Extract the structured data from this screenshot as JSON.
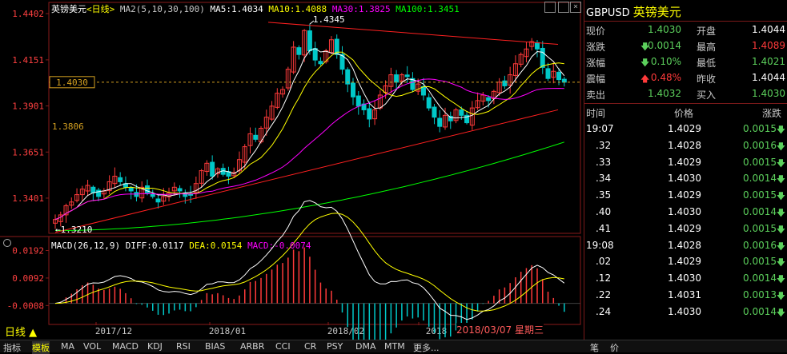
{
  "header": {
    "title": "英镑美元",
    "period": "<日线>",
    "ma_label": "MA2(5,10,30,100)",
    "ma5": "MA5:1.4034",
    "ma10": "MA10:1.4088",
    "ma30": "MA30:1.3825",
    "ma100": "MA100:1.3451"
  },
  "macd_header": {
    "label": "MACD(26,12,9)",
    "diff": "DIFF:0.0117",
    "dea": "DEA:0.0154",
    "macd": "MACD:-0.0074"
  },
  "annotations": {
    "high": "1.4345",
    "low": "1.3210",
    "current_tag": "1.4030",
    "support_label": "1.3806"
  },
  "price_axis": [
    "1.4402",
    "1.4151",
    "1.3901",
    "1.3651",
    "1.3401"
  ],
  "macd_axis": [
    "0.0192",
    "0.0092",
    "-0.0008"
  ],
  "x_axis": [
    "2017/12",
    "2018/01",
    "2018/02",
    "2018"
  ],
  "date_label": "2018/03/07 星期三",
  "period_button": "日线",
  "quote": {
    "symbol": "GBPUSD",
    "name": "英镑美元",
    "rows": [
      {
        "l1": "现价",
        "v1": "1.4030",
        "c1": "g",
        "l2": "开盘",
        "v2": "1.4044",
        "c2": "w"
      },
      {
        "l1": "涨跌",
        "v1": "0.0014",
        "c1": "g",
        "arrow1": "down",
        "l2": "最高",
        "v2": "1.4089",
        "c2": "r"
      },
      {
        "l1": "涨幅",
        "v1": "0.10%",
        "c1": "g",
        "arrow1": "down",
        "l2": "最低",
        "v2": "1.4021",
        "c2": "g"
      },
      {
        "l1": "震幅",
        "v1": "0.48%",
        "c1": "r",
        "arrow1": "up",
        "l2": "昨收",
        "v2": "1.4044",
        "c2": "w"
      },
      {
        "l1": "卖出",
        "v1": "1.4032",
        "c1": "g",
        "l2": "买入",
        "v2": "1.4030",
        "c2": "g"
      }
    ],
    "tick_headers": [
      "时间",
      "价格",
      "涨跌"
    ],
    "ticks": [
      {
        "time": "19:07",
        "price": "1.4029",
        "chg": "0.0015"
      },
      {
        "time": ".32",
        "price": "1.4028",
        "chg": "0.0016"
      },
      {
        "time": ".33",
        "price": "1.4029",
        "chg": "0.0015"
      },
      {
        "time": ".34",
        "price": "1.4030",
        "chg": "0.0014"
      },
      {
        "time": ".35",
        "price": "1.4029",
        "chg": "0.0015"
      },
      {
        "time": ".40",
        "price": "1.4030",
        "chg": "0.0014"
      },
      {
        "time": ".41",
        "price": "1.4029",
        "chg": "0.0015"
      },
      {
        "time": "19:08",
        "price": "1.4028",
        "chg": "0.0016"
      },
      {
        "time": ".02",
        "price": "1.4029",
        "chg": "0.0015"
      },
      {
        "time": ".12",
        "price": "1.4030",
        "chg": "0.0014"
      },
      {
        "time": ".22",
        "price": "1.4031",
        "chg": "0.0013"
      },
      {
        "time": ".24",
        "price": "1.4030",
        "chg": "0.0014"
      }
    ]
  },
  "bottom_tabs": [
    "指标",
    "模板",
    "MA",
    "VOL",
    "MACD",
    "KDJ",
    "RSI",
    "BIAS",
    "ARBR",
    "CCI",
    "CR",
    "PSY",
    "DMA",
    "MTM",
    "更多..."
  ],
  "bottom_right": [
    "笔",
    "价"
  ],
  "colors": {
    "up": "#ff3a3a",
    "down": "#00c8c8",
    "ma5": "#ffffff",
    "ma10": "#ffff00",
    "ma30": "#ff00ff",
    "ma100": "#00ff00",
    "trend": "#ff2020"
  },
  "chart_data": {
    "type": "candlestick",
    "title": "英镑美元 <日线>",
    "ylim": [
      1.321,
      1.4402
    ],
    "x": [
      "2017/12",
      "2018/01",
      "2018/02",
      "2018/03/07"
    ],
    "closes": [
      1.3285,
      1.331,
      1.336,
      1.338,
      1.342,
      1.345,
      1.347,
      1.343,
      1.341,
      1.344,
      1.349,
      1.352,
      1.349,
      1.346,
      1.344,
      1.341,
      1.346,
      1.343,
      1.341,
      1.338,
      1.341,
      1.343,
      1.346,
      1.344,
      1.341,
      1.342,
      1.348,
      1.355,
      1.359,
      1.352,
      1.356,
      1.353,
      1.352,
      1.354,
      1.361,
      1.368,
      1.375,
      1.372,
      1.378,
      1.384,
      1.39,
      1.397,
      1.399,
      1.41,
      1.422,
      1.418,
      1.431,
      1.42,
      1.415,
      1.413,
      1.42,
      1.426,
      1.418,
      1.41,
      1.402,
      1.395,
      1.39,
      1.388,
      1.383,
      1.388,
      1.396,
      1.401,
      1.407,
      1.403,
      1.407,
      1.406,
      1.399,
      1.402,
      1.396,
      1.389,
      1.384,
      1.379,
      1.385,
      1.382,
      1.388,
      1.385,
      1.381,
      1.389,
      1.393,
      1.396,
      1.393,
      1.398,
      1.403,
      1.401,
      1.407,
      1.413,
      1.418,
      1.421,
      1.425,
      1.421,
      1.411,
      1.405,
      1.4089,
      1.4044,
      1.403
    ]
  }
}
